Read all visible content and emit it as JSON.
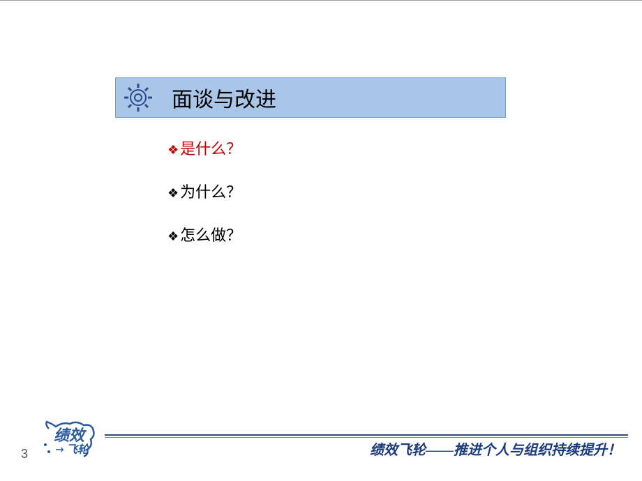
{
  "title": "面谈与改进",
  "bullets": [
    {
      "text": "是什么？",
      "highlight": true
    },
    {
      "text": "为什么？",
      "highlight": false
    },
    {
      "text": "怎么做？",
      "highlight": false
    }
  ],
  "bullet_marker": "❖",
  "page_number": "3",
  "footer_text": "绩效飞轮——推进个人与组织持续提升！",
  "logo_text_main": "绩效",
  "logo_text_sub": "飞轮"
}
